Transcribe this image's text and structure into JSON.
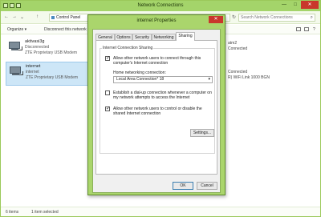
{
  "window": {
    "title": "Network Connections",
    "controls": {
      "minimize": "—",
      "maximize": "□",
      "close": "✕"
    }
  },
  "address": {
    "nav_back": "←",
    "nav_forward": "→",
    "nav_recent": "⌄",
    "nav_up": "↑",
    "path": "Control Panel",
    "search_placeholder": "Search Network Connections",
    "refresh": "↻"
  },
  "toolbar": {
    "organize": "Organize ▾",
    "disconnect": "Disconnect this network device",
    "help": "?"
  },
  "items": [
    {
      "name": "aktivasi3g",
      "status": "Disconnected",
      "device": "ZTE Proprietary USB Modem"
    },
    {
      "name": "internet",
      "status": "internet",
      "device": "ZTE Proprietary USB Modem"
    }
  ],
  "right_items": {
    "line1": "atm2",
    "line2": "Connected",
    "line3": "Connected",
    "line4": "R) WiFi Link 1000 BGN"
  },
  "status": {
    "count": "6 items",
    "selected": "1 item selected"
  },
  "dialog": {
    "title": "internet Properties",
    "close": "✕",
    "tabs": [
      "General",
      "Options",
      "Security",
      "Networking",
      "Sharing"
    ],
    "active_tab": "Sharing",
    "group_label": "Internet Connection Sharing",
    "allow_connect": {
      "checked": "✓",
      "line1": "Allow other network users to connect through this",
      "line2": "computer's Internet connection"
    },
    "home_label": "Home networking connection:",
    "home_value": "Local Area Connection* 18",
    "establish": {
      "checked": "",
      "line1": "Establish a dial-up connection whenever a computer on",
      "line2": "my network attempts to access the Internet"
    },
    "allow_control": {
      "checked": "✓",
      "line1": "Allow other network users to control or disable the",
      "line2": "shared Internet connection"
    },
    "settings_label": "Settings...",
    "ok_label": "OK",
    "cancel_label": "Cancel"
  },
  "colors": {
    "accent": "#a4d46a",
    "selection": "#cde6f7",
    "close": "#c9372c"
  }
}
